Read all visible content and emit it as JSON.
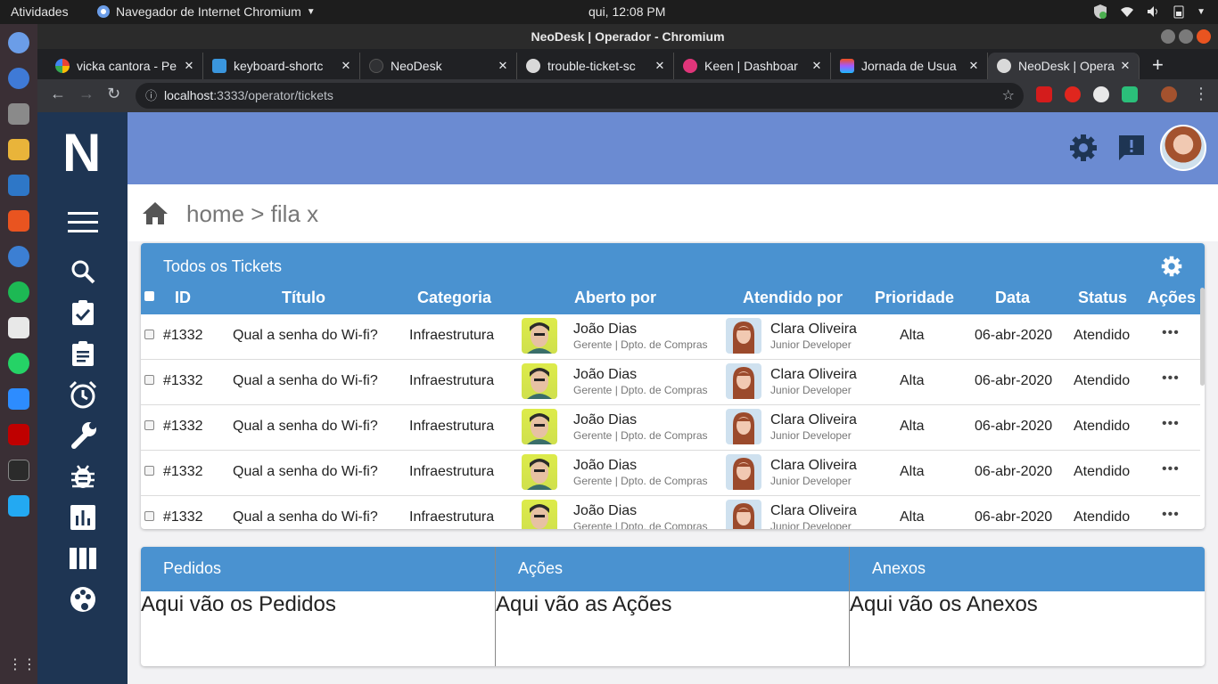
{
  "os": {
    "activities": "Atividades",
    "app_menu": "Navegador de Internet Chromium",
    "clock": "qui, 12:08 PM"
  },
  "window": {
    "title": "NeoDesk | Operador - Chromium"
  },
  "tabs": [
    {
      "title": "vicka cantora - Pe",
      "color": "#ffffff"
    },
    {
      "title": "keyboard-shortc",
      "color": "#3a96dd"
    },
    {
      "title": "NeoDesk",
      "color": "#303134"
    },
    {
      "title": "trouble-ticket-sc",
      "color": "#d9d9d9"
    },
    {
      "title": "Keen | Dashboar",
      "color": "#e0357a"
    },
    {
      "title": "Jornada de Usua",
      "color": "#f24e1e"
    },
    {
      "title": "NeoDesk | Opera",
      "color": "#d9d9d9"
    }
  ],
  "url": {
    "host": "localhost",
    "path": ":3333/operator/tickets"
  },
  "breadcrumb": "home > fila x",
  "tickets": {
    "title": "Todos os Tickets",
    "columns": [
      "ID",
      "Título",
      "Categoria",
      "Aberto por",
      "Atendido por",
      "Prioridade",
      "Data",
      "Status",
      "Ações"
    ],
    "rows": [
      {
        "id": "#1332",
        "titulo": "Qual a senha do Wi-fi?",
        "categoria": "Infraestrutura",
        "aberto_nome": "João Dias",
        "aberto_cargo": "Gerente | Dpto. de Compras",
        "atendido_nome": "Clara Oliveira",
        "atendido_cargo": "Junior Developer",
        "prioridade": "Alta",
        "data": "06-abr-2020",
        "status": "Atendido",
        "acoes": "•••"
      },
      {
        "id": "#1332",
        "titulo": "Qual a senha do Wi-fi?",
        "categoria": "Infraestrutura",
        "aberto_nome": "João Dias",
        "aberto_cargo": "Gerente | Dpto. de Compras",
        "atendido_nome": "Clara Oliveira",
        "atendido_cargo": "Junior Developer",
        "prioridade": "Alta",
        "data": "06-abr-2020",
        "status": "Atendido",
        "acoes": "•••"
      },
      {
        "id": "#1332",
        "titulo": "Qual a senha do Wi-fi?",
        "categoria": "Infraestrutura",
        "aberto_nome": "João Dias",
        "aberto_cargo": "Gerente | Dpto. de Compras",
        "atendido_nome": "Clara Oliveira",
        "atendido_cargo": "Junior Developer",
        "prioridade": "Alta",
        "data": "06-abr-2020",
        "status": "Atendido",
        "acoes": "•••"
      },
      {
        "id": "#1332",
        "titulo": "Qual a senha do Wi-fi?",
        "categoria": "Infraestrutura",
        "aberto_nome": "João Dias",
        "aberto_cargo": "Gerente | Dpto. de Compras",
        "atendido_nome": "Clara Oliveira",
        "atendido_cargo": "Junior Developer",
        "prioridade": "Alta",
        "data": "06-abr-2020",
        "status": "Atendido",
        "acoes": "•••"
      },
      {
        "id": "#1332",
        "titulo": "Qual a senha do Wi-fi?",
        "categoria": "Infraestrutura",
        "aberto_nome": "João Dias",
        "aberto_cargo": "Gerente | Dpto. de Compras",
        "atendido_nome": "Clara Oliveira",
        "atendido_cargo": "Junior Developer",
        "prioridade": "Alta",
        "data": "06-abr-2020",
        "status": "Atendido",
        "acoes": "•••"
      }
    ]
  },
  "panels": [
    {
      "title": "Pedidos",
      "body": "Aqui vão os Pedidos"
    },
    {
      "title": "Ações",
      "body": "Aqui vão as Ações"
    },
    {
      "title": "Anexos",
      "body": "Aqui vão os Anexos"
    }
  ],
  "brand": {
    "logo": "N",
    "header_color": "#6b8bd2",
    "sidebar_color": "#1e3553",
    "accent": "#4a92d0"
  },
  "icons": {
    "sidebar": [
      "menu-icon",
      "search-icon",
      "assignment-done-icon",
      "clipboard-icon",
      "alarm-icon",
      "wrench-icon",
      "bug-icon",
      "chart-icon",
      "columns-icon",
      "palette-icon"
    ],
    "header": [
      "settings-icon",
      "feedback-icon",
      "user-avatar"
    ]
  }
}
